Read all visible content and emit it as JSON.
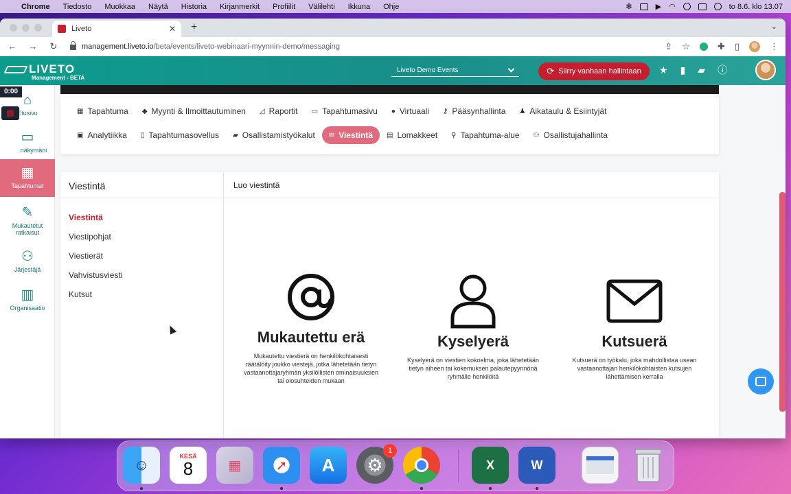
{
  "menubar": {
    "app": "Chrome",
    "menus": [
      "Tiedosto",
      "Muokkaa",
      "Näytä",
      "Historia",
      "Kirjanmerkit",
      "Profiilit",
      "Välilehti",
      "Ikkuna",
      "Ohje"
    ],
    "clock": "to 8.6. klo 13.07"
  },
  "browser": {
    "tab_title": "Liveto",
    "url_host": "management.liveto.io",
    "url_path": "/beta/events/liveto-webinaari-myynnin-demo/messaging"
  },
  "header": {
    "brand": "LIVETO",
    "brand_sub": "Management - BETA",
    "event_select": "Liveto Demo Events",
    "legacy_button": "Siirry vanhaan hallintaan"
  },
  "leftnav": {
    "timer": "0:00",
    "items": [
      {
        "label": "Etusivu"
      },
      {
        "label": "näkymäni"
      },
      {
        "label": "Tapahtumat"
      },
      {
        "label": "Mukautetut ratkaisut"
      },
      {
        "label": "Järjestäjä"
      },
      {
        "label": "Organisaatio"
      }
    ]
  },
  "subnav": {
    "row1": [
      "Tapahtuma",
      "Myynti & Ilmoittautuminen",
      "Raportit",
      "Tapahtumasivu",
      "Virtuaali",
      "Pääsynhallinta",
      "Aikataulu & Esiintyjät"
    ],
    "row2": [
      "Analytiikka",
      "Tapahtumasovellus",
      "Osallistamistyökalut",
      "Viestintä",
      "Lomakkeet",
      "Tapahtuma-alue",
      "Osallistujahallinta"
    ]
  },
  "panel": {
    "left_title": "Viestintä",
    "menu": [
      "Viestintä",
      "Viestipohjat",
      "Viestierät",
      "Vahvistusviesti",
      "Kutsut"
    ],
    "right_title": "Luo viestintä",
    "options": [
      {
        "title": "Mukautettu erä",
        "desc": "Mukautettu viestierä on henkilökohtaisesti räätälöity joukko viestejä, jotka lähetetään tietyn vastaanottajaryhmän yksilöllisten ominaisuuksien tai olosuhteiden mukaan"
      },
      {
        "title": "Kyselyerä",
        "desc": "Kyselyerä on viestien kokoelma, joka lähetetään tietyn aiheen tai kokemuksen palautepyynnönä ryhmälle henkilöitä"
      },
      {
        "title": "Kutsuerä",
        "desc": "Kutsuerä on työkalu, joka mahdollistaa usean vastaanottajan henkilökohtaisten kutsujen lähettämisen kerralla"
      }
    ]
  },
  "dock": {
    "calendar_month": "KESÄ",
    "calendar_day": "8",
    "settings_badge": "1"
  },
  "colors": {
    "brand_teal": "#0c9c8c",
    "accent_red": "#c51e2e",
    "active_pink": "#e16a7e"
  }
}
